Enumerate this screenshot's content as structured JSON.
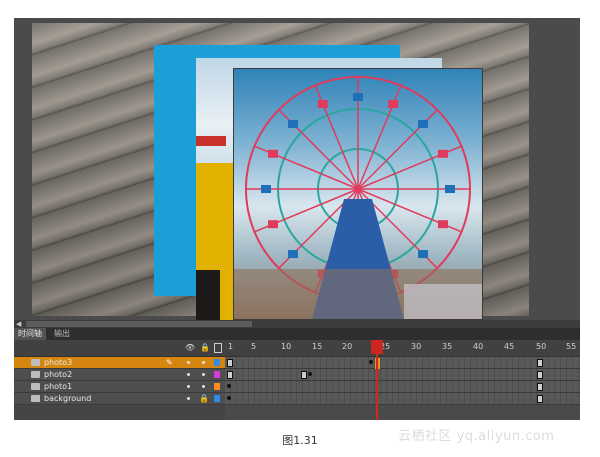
{
  "panel_tabs": [
    {
      "label": "时间轴",
      "active": true
    },
    {
      "label": "输出",
      "active": false
    }
  ],
  "timeline": {
    "header_icons": [
      "eye-icon",
      "lock-icon",
      "outline-icon"
    ],
    "frame_numbers": [
      "1",
      "5",
      "10",
      "15",
      "20",
      "25",
      "30",
      "35",
      "40",
      "45",
      "50",
      "55"
    ],
    "current_frame": 25,
    "layers": [
      {
        "name": "photo3",
        "selected": true,
        "locked": false,
        "color": "#2e8be6"
      },
      {
        "name": "photo2",
        "selected": false,
        "locked": false,
        "color": "#d63ad9"
      },
      {
        "name": "photo1",
        "selected": false,
        "locked": false,
        "color": "#ff8a1e"
      },
      {
        "name": "background",
        "selected": false,
        "locked": true,
        "color": "#2e8be6"
      }
    ]
  },
  "caption": "图1.31",
  "watermark": "云栖社区 yq.aliyun.com"
}
